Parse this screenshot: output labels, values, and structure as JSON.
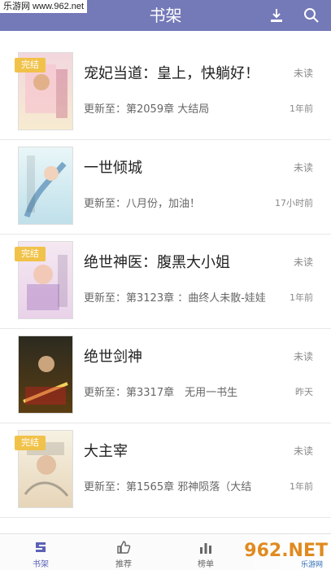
{
  "header": {
    "watermark_top": "乐游网 www.962.net",
    "title": "书架"
  },
  "books": [
    {
      "badge": "完结",
      "title": "宠妃当道：皇上，快躺好！",
      "status": "未读",
      "update": "更新至：第2059章 大结局",
      "time": "1年前"
    },
    {
      "badge": "",
      "title": "一世倾城",
      "status": "未读",
      "update": "更新至：八月份，加油！",
      "time": "17小时前"
    },
    {
      "badge": "完结",
      "title": "绝世神医：腹黑大小姐",
      "status": "未读",
      "update": "更新至：第3123章 ：曲终人未散-娃娃",
      "time": "1年前"
    },
    {
      "badge": "",
      "title": "绝世剑神",
      "status": "未读",
      "update": "更新至：第3317章　无用一书生",
      "time": "昨天"
    },
    {
      "badge": "完结",
      "title": "大主宰",
      "status": "未读",
      "update": "更新至：第1565章 邪神陨落（大结",
      "time": "1年前"
    }
  ],
  "tabs": [
    {
      "label": "书架"
    },
    {
      "label": "推荐"
    },
    {
      "label": "榜单"
    }
  ],
  "watermark_bottom": {
    "brand": "962.NET",
    "site": "乐游网"
  },
  "colors": {
    "header": "#7479b8",
    "badge": "#f1c24a",
    "active_tab": "#5b62b6"
  }
}
